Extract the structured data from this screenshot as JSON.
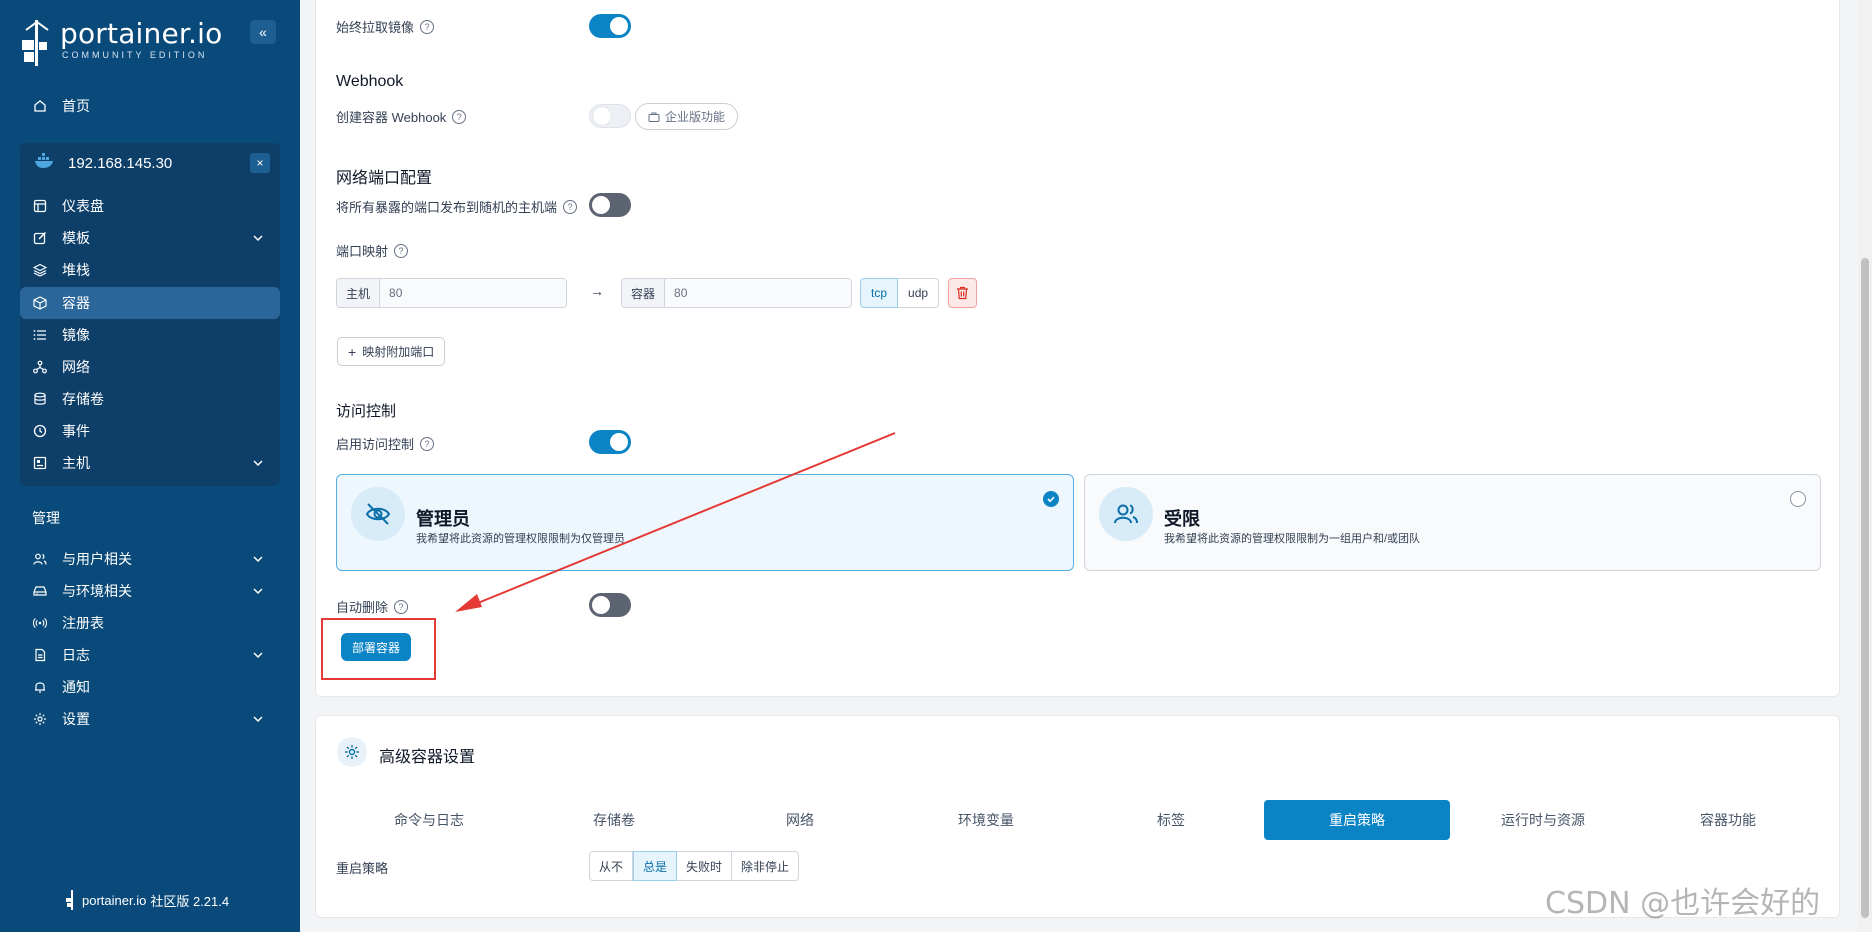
{
  "sidebar": {
    "logo": {
      "name": "portainer.io",
      "edition": "COMMUNITY EDITION"
    },
    "home": "首页",
    "environment": {
      "name": "192.168.145.30",
      "close": "×"
    },
    "env_items": [
      {
        "label": "仪表盘"
      },
      {
        "label": "模板"
      },
      {
        "label": "堆栈"
      },
      {
        "label": "容器"
      },
      {
        "label": "镜像"
      },
      {
        "label": "网络"
      },
      {
        "label": "存储卷"
      },
      {
        "label": "事件"
      },
      {
        "label": "主机"
      }
    ],
    "admin_title": "管理",
    "admin_items": [
      {
        "label": "与用户相关"
      },
      {
        "label": "与环境相关"
      },
      {
        "label": "注册表"
      },
      {
        "label": "日志"
      },
      {
        "label": "通知"
      },
      {
        "label": "设置"
      }
    ],
    "footer": {
      "name": "portainer.io",
      "version": "社区版 2.21.4"
    }
  },
  "form": {
    "always_pull": {
      "label": "始终拉取镜像",
      "enabled": true
    },
    "webhook": {
      "heading": "Webhook",
      "label": "创建容器 Webhook",
      "badge": "企业版功能",
      "enabled": false
    },
    "ports": {
      "heading": "网络端口配置",
      "publish_all_label": "将所有暴露的端口发布到随机的主机端",
      "publish_all": false,
      "mapping_label": "端口映射",
      "host_addon": "主机",
      "host_value": "80",
      "arrow": "→",
      "container_addon": "容器",
      "container_value": "80",
      "proto_tcp": "tcp",
      "proto_udp": "udp",
      "add_button": "映射附加端口"
    },
    "access": {
      "heading": "访问控制",
      "enable_label": "启用访问控制",
      "enabled": true,
      "admin": {
        "title": "管理员",
        "desc": "我希望将此资源的管理权限限制为仅管理员"
      },
      "restricted": {
        "title": "受限",
        "desc": "我希望将此资源的管理权限限制为一组用户和/或团队"
      }
    },
    "auto_remove": {
      "label": "自动删除",
      "enabled": false
    },
    "deploy_button": "部署容器"
  },
  "advanced": {
    "title": "高级容器设置",
    "tabs": [
      "命令与日志",
      "存储卷",
      "网络",
      "环境变量",
      "标签",
      "重启策略",
      "运行时与资源",
      "容器功能"
    ],
    "active_tab": "重启策略",
    "restart_label": "重启策略",
    "restart_options": [
      "从不",
      "总是",
      "失败时",
      "除非停止"
    ],
    "restart_selected": "总是"
  },
  "watermark": "CSDN @也许会好的",
  "colors": {
    "sidebar": "#0a4a7a",
    "accent": "#0b84c6",
    "annotation": "#e53935"
  }
}
